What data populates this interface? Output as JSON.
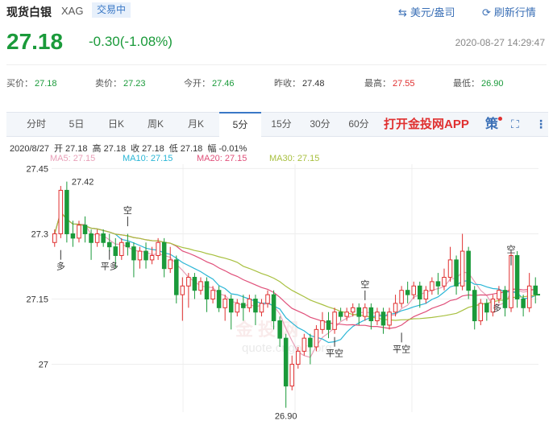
{
  "header": {
    "name": "现货白银",
    "code": "XAG",
    "status": "交易中",
    "currency_btn": "美元/盎司",
    "refresh_btn": "刷新行情"
  },
  "quote": {
    "price": "27.18",
    "change": "-0.30(-1.08%)",
    "time": "2020-08-27 14:29:47"
  },
  "stats": [
    {
      "label": "买价：",
      "value": "27.18",
      "color": "#1a9a3a"
    },
    {
      "label": "卖价：",
      "value": "27.23",
      "color": "#1a9a3a"
    },
    {
      "label": "今开：",
      "value": "27.46",
      "color": "#1a9a3a"
    },
    {
      "label": "昨收：",
      "value": "27.48",
      "color": "#333"
    },
    {
      "label": "最高：",
      "value": "27.55",
      "color": "#e03030"
    },
    {
      "label": "最低：",
      "value": "26.90",
      "color": "#1a9a3a"
    }
  ],
  "tabs": [
    "分时",
    "5日",
    "日K",
    "周K",
    "月K",
    "5分",
    "15分",
    "30分",
    "60分"
  ],
  "active_tab": 5,
  "app_text": "打开金投网APP",
  "strategy_icon": "策",
  "info": {
    "date": "2020/8/27",
    "open": "开 27.18",
    "high": "高 27.18",
    "close": "收 27.18",
    "low": "低 27.18",
    "amp": "幅 -0.01%"
  },
  "ma_legend": [
    {
      "text": "MA5: 27.15",
      "color": "#e8a0b8"
    },
    {
      "text": "MA10: 27.15",
      "color": "#2ab6d6"
    },
    {
      "text": "MA20: 27.15",
      "color": "#e0507a"
    },
    {
      "text": "MA30: 27.15",
      "color": "#a8c040"
    }
  ],
  "watermark": {
    "line1": "金 投 网",
    "line2": "quote.cngold.org"
  },
  "chart_data": {
    "type": "candlestick",
    "ylim": [
      26.89,
      27.46
    ],
    "y_ticks": [
      "27.45",
      "27.3",
      "27.15",
      "27"
    ],
    "max_label": "27.42",
    "min_label": "26.90",
    "up_color": "#e03030",
    "down_color": "#1a9a3a",
    "candles": [
      [
        27.28,
        27.3,
        27.31,
        27.27
      ],
      [
        27.3,
        27.4,
        27.41,
        27.29
      ],
      [
        27.4,
        27.3,
        27.42,
        27.28
      ],
      [
        27.3,
        27.29,
        27.33,
        27.27
      ],
      [
        27.29,
        27.32,
        27.33,
        27.28
      ],
      [
        27.32,
        27.3,
        27.34,
        27.28
      ],
      [
        27.3,
        27.28,
        27.31,
        27.24
      ],
      [
        27.28,
        27.3,
        27.31,
        27.27
      ],
      [
        27.3,
        27.28,
        27.31,
        27.27
      ],
      [
        27.28,
        27.27,
        27.3,
        27.26
      ],
      [
        27.27,
        27.25,
        27.29,
        27.22
      ],
      [
        27.25,
        27.28,
        27.29,
        27.24
      ],
      [
        27.28,
        27.27,
        27.3,
        27.25
      ],
      [
        27.27,
        27.24,
        27.28,
        27.2
      ],
      [
        27.24,
        27.26,
        27.27,
        27.22
      ],
      [
        27.26,
        27.24,
        27.28,
        27.22
      ],
      [
        27.24,
        27.25,
        27.27,
        27.23
      ],
      [
        27.25,
        27.28,
        27.29,
        27.24
      ],
      [
        27.28,
        27.22,
        27.29,
        27.2
      ],
      [
        27.22,
        27.24,
        27.27,
        27.21
      ],
      [
        27.24,
        27.16,
        27.25,
        27.14
      ],
      [
        27.16,
        27.18,
        27.2,
        27.1
      ],
      [
        27.18,
        27.2,
        27.21,
        27.13
      ],
      [
        27.2,
        27.17,
        27.21,
        27.15
      ],
      [
        27.17,
        27.19,
        27.2,
        27.16
      ],
      [
        27.19,
        27.15,
        27.2,
        27.12
      ],
      [
        27.15,
        27.17,
        27.18,
        27.14
      ],
      [
        27.17,
        27.13,
        27.18,
        27.12
      ],
      [
        27.13,
        27.15,
        27.16,
        27.1
      ],
      [
        27.15,
        27.12,
        27.16,
        27.08
      ],
      [
        27.12,
        27.14,
        27.15,
        27.11
      ],
      [
        27.14,
        27.13,
        27.16,
        27.1
      ],
      [
        27.13,
        27.15,
        27.16,
        27.12
      ],
      [
        27.15,
        27.12,
        27.16,
        27.09
      ],
      [
        27.12,
        27.14,
        27.15,
        27.11
      ],
      [
        27.14,
        27.16,
        27.17,
        27.13
      ],
      [
        27.16,
        27.1,
        27.17,
        27.08
      ],
      [
        27.1,
        27.06,
        27.11,
        27.04
      ],
      [
        27.06,
        26.95,
        27.07,
        26.9
      ],
      [
        26.95,
        27.0,
        27.02,
        26.94
      ],
      [
        27.0,
        27.03,
        27.04,
        26.99
      ],
      [
        27.03,
        27.06,
        27.07,
        27.02
      ],
      [
        27.06,
        27.04,
        27.07,
        27.0
      ],
      [
        27.04,
        27.08,
        27.09,
        27.03
      ],
      [
        27.08,
        27.1,
        27.12,
        27.07
      ],
      [
        27.1,
        27.08,
        27.12,
        27.06
      ],
      [
        27.08,
        27.12,
        27.13,
        27.07
      ],
      [
        27.12,
        27.11,
        27.13,
        27.1
      ],
      [
        27.11,
        27.12,
        27.13,
        27.1
      ],
      [
        27.12,
        27.13,
        27.14,
        27.11
      ],
      [
        27.13,
        27.11,
        27.14,
        27.09
      ],
      [
        27.11,
        27.13,
        27.14,
        27.1
      ],
      [
        27.13,
        27.1,
        27.14,
        27.08
      ],
      [
        27.1,
        27.12,
        27.13,
        27.09
      ],
      [
        27.12,
        27.09,
        27.13,
        27.07
      ],
      [
        27.09,
        27.12,
        27.13,
        27.08
      ],
      [
        27.12,
        27.14,
        27.16,
        27.11
      ],
      [
        27.14,
        27.17,
        27.18,
        27.13
      ],
      [
        27.17,
        27.16,
        27.19,
        27.14
      ],
      [
        27.16,
        27.18,
        27.19,
        27.15
      ],
      [
        27.18,
        27.15,
        27.19,
        27.13
      ],
      [
        27.15,
        27.17,
        27.18,
        27.14
      ],
      [
        27.17,
        27.19,
        27.2,
        27.16
      ],
      [
        27.19,
        27.18,
        27.21,
        27.16
      ],
      [
        27.18,
        27.2,
        27.22,
        27.17
      ],
      [
        27.2,
        27.24,
        27.27,
        27.19
      ],
      [
        27.24,
        27.18,
        27.25,
        27.16
      ],
      [
        27.18,
        27.26,
        27.3,
        27.17
      ],
      [
        27.26,
        27.17,
        27.27,
        27.15
      ],
      [
        27.17,
        27.1,
        27.18,
        27.08
      ],
      [
        27.1,
        27.14,
        27.15,
        27.09
      ],
      [
        27.14,
        27.12,
        27.15,
        27.1
      ],
      [
        27.12,
        27.15,
        27.16,
        27.11
      ],
      [
        27.15,
        27.17,
        27.18,
        27.14
      ],
      [
        27.17,
        27.13,
        27.18,
        27.11
      ],
      [
        27.13,
        27.25,
        27.26,
        27.12
      ],
      [
        27.25,
        27.15,
        27.26,
        27.13
      ],
      [
        27.15,
        27.13,
        27.16,
        27.11
      ],
      [
        27.13,
        27.18,
        27.21,
        27.12
      ],
      [
        27.18,
        27.16,
        27.2,
        27.14
      ]
    ],
    "markers": [
      {
        "text": "多",
        "idx": 1,
        "price": 27.27,
        "side": "below"
      },
      {
        "text": "平多",
        "idx": 9,
        "price": 27.27,
        "side": "below"
      },
      {
        "text": "空",
        "idx": 12,
        "price": 27.31,
        "side": "above"
      },
      {
        "text": "平空",
        "idx": 46,
        "price": 27.07,
        "side": "below"
      },
      {
        "text": "空",
        "idx": 51,
        "price": 27.14,
        "side": "above"
      },
      {
        "text": "平空",
        "idx": 57,
        "price": 27.08,
        "side": "below"
      },
      {
        "text": "多",
        "idx": 74,
        "price": 27.13,
        "side": "left"
      },
      {
        "text": "空",
        "idx": 75,
        "price": 27.22,
        "side": "above"
      }
    ]
  }
}
